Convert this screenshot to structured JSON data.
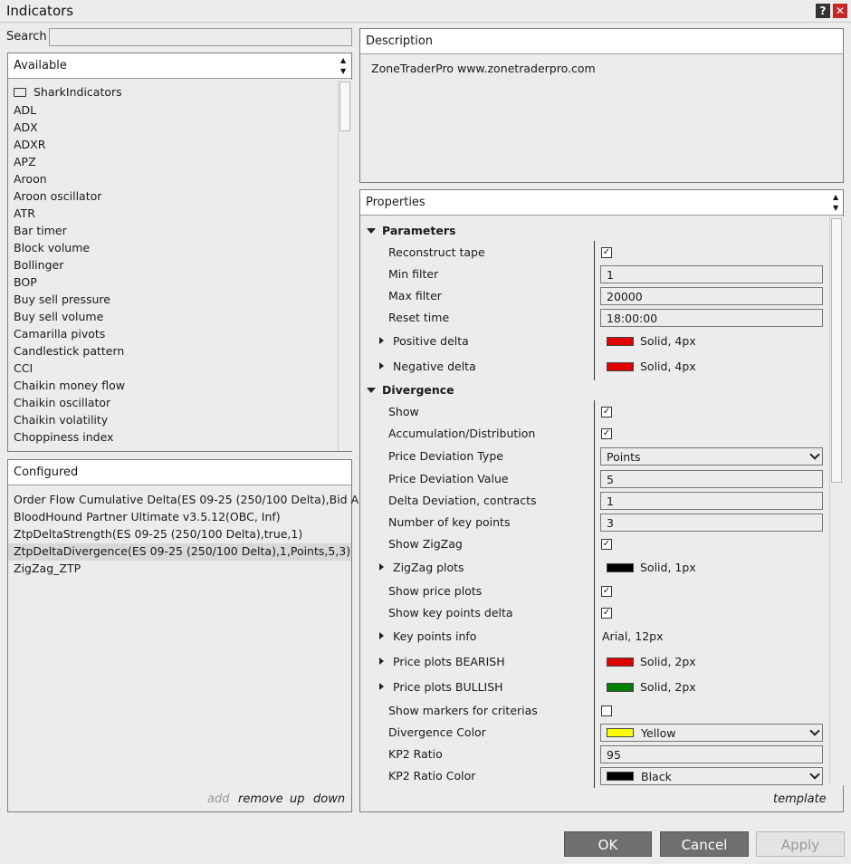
{
  "window": {
    "title": "Indicators",
    "help": "?",
    "close": "✕"
  },
  "search": {
    "label": "Search",
    "value": ""
  },
  "available": {
    "header": "Available",
    "folder": "SharkIndicators",
    "items": [
      "ADL",
      "ADX",
      "ADXR",
      "APZ",
      "Aroon",
      "Aroon oscillator",
      "ATR",
      "Bar timer",
      "Block volume",
      "Bollinger",
      "BOP",
      "Buy sell pressure",
      "Buy sell volume",
      "Camarilla pivots",
      "Candlestick pattern",
      "CCI",
      "Chaikin money flow",
      "Chaikin oscillator",
      "Chaikin volatility",
      "Choppiness index"
    ]
  },
  "configured": {
    "header": "Configured",
    "items": [
      "Order Flow Cumulative Delta(ES 09-25 (250/100 Delta),Bid A...",
      "BloodHound Partner Ultimate v3.5.12(OBC, Inf)",
      "ZtpDeltaStrength(ES 09-25 (250/100 Delta),true,1)",
      "ZtpDeltaDivergence(ES 09-25 (250/100 Delta),1,Points,5,3)",
      "ZigZag_ZTP"
    ],
    "actions": {
      "add": "add",
      "remove": "remove",
      "up": "up",
      "down": "down"
    }
  },
  "description": {
    "header": "Description",
    "text": "ZoneTraderPro www.zonetraderpro.com"
  },
  "properties": {
    "header": "Properties",
    "parameters": {
      "title": "Parameters",
      "reconstruct_tape": {
        "label": "Reconstruct tape",
        "checked": "✓"
      },
      "min_filter": {
        "label": "Min filter",
        "value": "1"
      },
      "max_filter": {
        "label": "Max filter",
        "value": "20000"
      },
      "reset_time": {
        "label": "Reset time",
        "value": "18:00:00"
      },
      "positive_delta": {
        "label": "Positive delta",
        "value": "Solid, 4px",
        "color": "#e00000"
      },
      "negative_delta": {
        "label": "Negative delta",
        "value": "Solid, 4px",
        "color": "#e00000"
      }
    },
    "divergence": {
      "title": "Divergence",
      "show": {
        "label": "Show",
        "checked": "✓"
      },
      "accum": {
        "label": "Accumulation/Distribution",
        "checked": "✓"
      },
      "price_dev_type": {
        "label": "Price Deviation Type",
        "value": "Points"
      },
      "price_dev_value": {
        "label": "Price Deviation Value",
        "value": "5"
      },
      "delta_dev": {
        "label": "Delta Deviation, contracts",
        "value": "1"
      },
      "key_points": {
        "label": "Number of key points",
        "value": "3"
      },
      "show_zigzag": {
        "label": "Show ZigZag",
        "checked": "✓"
      },
      "zigzag_plots": {
        "label": "ZigZag plots",
        "value": "Solid, 1px",
        "color": "#000000"
      },
      "show_price_plots": {
        "label": "Show price plots",
        "checked": "✓"
      },
      "show_kp_delta": {
        "label": "Show key points delta",
        "checked": "✓"
      },
      "kp_info": {
        "label": "Key points info",
        "value": "Arial, 12px"
      },
      "plots_bearish": {
        "label": "Price plots BEARISH",
        "value": "Solid, 2px",
        "color": "#e00000"
      },
      "plots_bullish": {
        "label": "Price plots BULLISH",
        "value": "Solid, 2px",
        "color": "#008000"
      },
      "show_markers": {
        "label": "Show markers for criterias",
        "checked": ""
      },
      "div_color": {
        "label": "Divergence Color",
        "value": "Yellow",
        "color": "#ffff00"
      },
      "kp2_ratio": {
        "label": "KP2 Ratio",
        "value": "95"
      },
      "kp2_ratio_color": {
        "label": "KP2 Ratio Color",
        "value": "Black",
        "color": "#000000"
      }
    },
    "template": "template"
  },
  "buttons": {
    "ok": "OK",
    "cancel": "Cancel",
    "apply": "Apply"
  }
}
